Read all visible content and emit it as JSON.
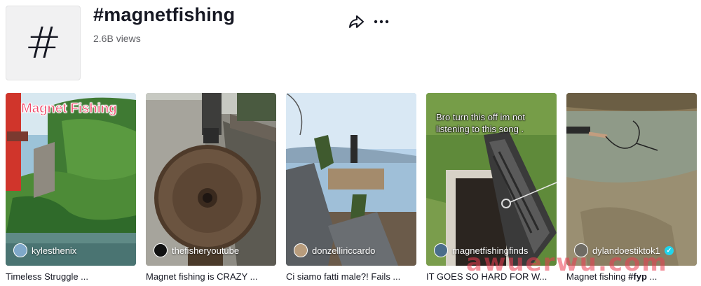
{
  "header": {
    "hash_symbol": "#",
    "title": "#magnetfishing",
    "views": "2.6B views"
  },
  "videos": [
    {
      "author": "kylesthenix",
      "caption": "Timeless Struggle ...",
      "overlay": "Magnet Fishing"
    },
    {
      "author": "thefisheryoutube",
      "caption": "Magnet fishing is CRAZY ..."
    },
    {
      "author": "donzelliriccardo",
      "caption": "Ci siamo fatti male?! Fails ..."
    },
    {
      "author": "magnetfishingfinds",
      "caption": "IT GOES SO HARD FOR W...",
      "overlay": "Bro turn this off im not listening to this song ."
    },
    {
      "author": "dylandoestiktok1",
      "caption_plain": "Magnet fishing ",
      "caption_bold": "#fyp",
      "caption_tail": " ...",
      "verified": true
    }
  ],
  "watermark": "awuerwu.com",
  "colors": {
    "accent_title": "#f04a6a",
    "verified": "#20d5ec",
    "watermark": "#eb3c50"
  }
}
